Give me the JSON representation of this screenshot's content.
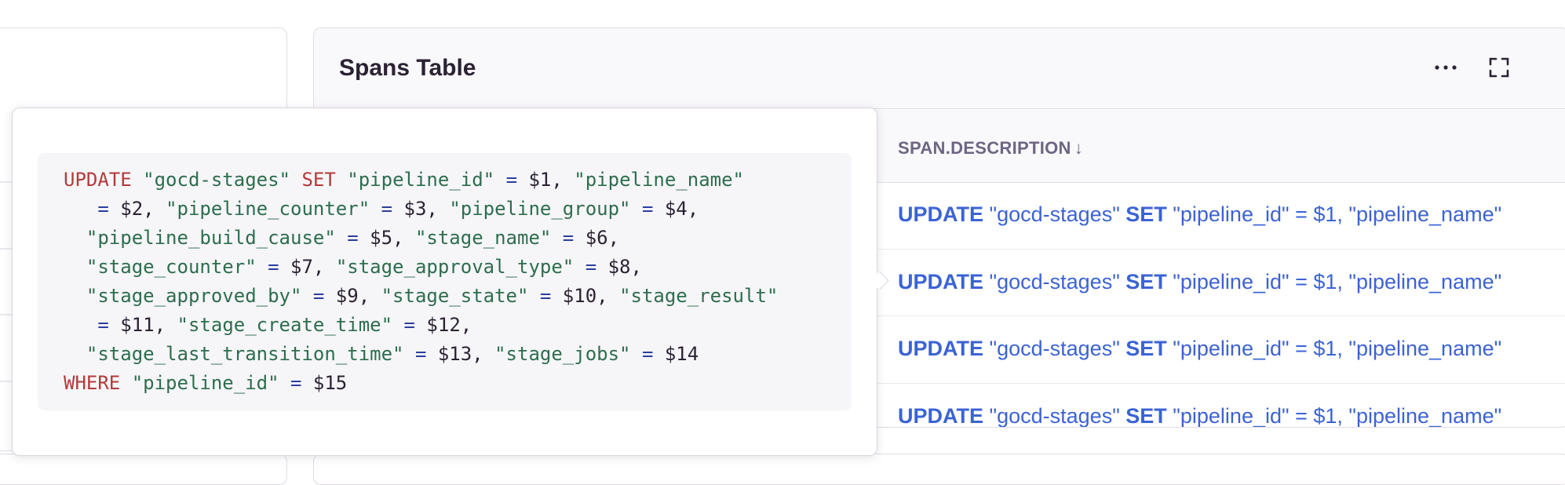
{
  "spans_table": {
    "title": "Spans Table",
    "more_icon": "ellipsis-icon",
    "expand_icon": "fullscreen-icon",
    "column_header": "SPAN.DESCRIPTION",
    "sort_indicator": "↓",
    "rows": [
      {
        "kw1": "UPDATE",
        "t1": " \"gocd-stages\" ",
        "kw2": "SET",
        "t2": " \"pipeline_id\" = $1, \"pipeline_name\""
      },
      {
        "kw1": "UPDATE",
        "t1": " \"gocd-stages\" ",
        "kw2": "SET",
        "t2": " \"pipeline_id\" = $1, \"pipeline_name\""
      },
      {
        "kw1": "UPDATE",
        "t1": " \"gocd-stages\" ",
        "kw2": "SET",
        "t2": " \"pipeline_id\" = $1, \"pipeline_name\""
      },
      {
        "kw1": "UPDATE",
        "t1": " \"gocd-stages\" ",
        "kw2": "SET",
        "t2": " \"pipeline_id\" = $1, \"pipeline_name\""
      }
    ]
  },
  "tooltip": {
    "code_lines": [
      [
        [
          "kw",
          "UPDATE"
        ],
        [
          "p",
          " "
        ],
        [
          "str",
          "\"gocd-stages\""
        ],
        [
          "p",
          " "
        ],
        [
          "kw",
          "SET"
        ],
        [
          "p",
          " "
        ],
        [
          "str",
          "\"pipeline_id\""
        ],
        [
          "p",
          " "
        ],
        [
          "op",
          "="
        ],
        [
          "p",
          " $1, "
        ],
        [
          "str",
          "\"pipeline_name\""
        ]
      ],
      [
        [
          "p",
          "   "
        ],
        [
          "op",
          "="
        ],
        [
          "p",
          " $2, "
        ],
        [
          "str",
          "\"pipeline_counter\""
        ],
        [
          "p",
          " "
        ],
        [
          "op",
          "="
        ],
        [
          "p",
          " $3, "
        ],
        [
          "str",
          "\"pipeline_group\""
        ],
        [
          "p",
          " "
        ],
        [
          "op",
          "="
        ],
        [
          "p",
          " $4,"
        ]
      ],
      [
        [
          "p",
          "  "
        ],
        [
          "str",
          "\"pipeline_build_cause\""
        ],
        [
          "p",
          " "
        ],
        [
          "op",
          "="
        ],
        [
          "p",
          " $5, "
        ],
        [
          "str",
          "\"stage_name\""
        ],
        [
          "p",
          " "
        ],
        [
          "op",
          "="
        ],
        [
          "p",
          " $6,"
        ]
      ],
      [
        [
          "p",
          "  "
        ],
        [
          "str",
          "\"stage_counter\""
        ],
        [
          "p",
          " "
        ],
        [
          "op",
          "="
        ],
        [
          "p",
          " $7, "
        ],
        [
          "str",
          "\"stage_approval_type\""
        ],
        [
          "p",
          " "
        ],
        [
          "op",
          "="
        ],
        [
          "p",
          " $8,"
        ]
      ],
      [
        [
          "p",
          "  "
        ],
        [
          "str",
          "\"stage_approved_by\""
        ],
        [
          "p",
          " "
        ],
        [
          "op",
          "="
        ],
        [
          "p",
          " $9, "
        ],
        [
          "str",
          "\"stage_state\""
        ],
        [
          "p",
          " "
        ],
        [
          "op",
          "="
        ],
        [
          "p",
          " $10, "
        ],
        [
          "str",
          "\"stage_result\""
        ]
      ],
      [
        [
          "p",
          "   "
        ],
        [
          "op",
          "="
        ],
        [
          "p",
          " $11, "
        ],
        [
          "str",
          "\"stage_create_time\""
        ],
        [
          "p",
          " "
        ],
        [
          "op",
          "="
        ],
        [
          "p",
          " $12,"
        ]
      ],
      [
        [
          "p",
          "  "
        ],
        [
          "str",
          "\"stage_last_transition_time\""
        ],
        [
          "p",
          " "
        ],
        [
          "op",
          "="
        ],
        [
          "p",
          " $13, "
        ],
        [
          "str",
          "\"stage_jobs\""
        ],
        [
          "p",
          " "
        ],
        [
          "op",
          "="
        ],
        [
          "p",
          " $14"
        ]
      ],
      [
        [
          "kw",
          "WHERE"
        ],
        [
          "p",
          " "
        ],
        [
          "str",
          "\"pipeline_id\""
        ],
        [
          "p",
          " "
        ],
        [
          "op",
          "="
        ],
        [
          "p",
          " $15"
        ]
      ]
    ]
  }
}
